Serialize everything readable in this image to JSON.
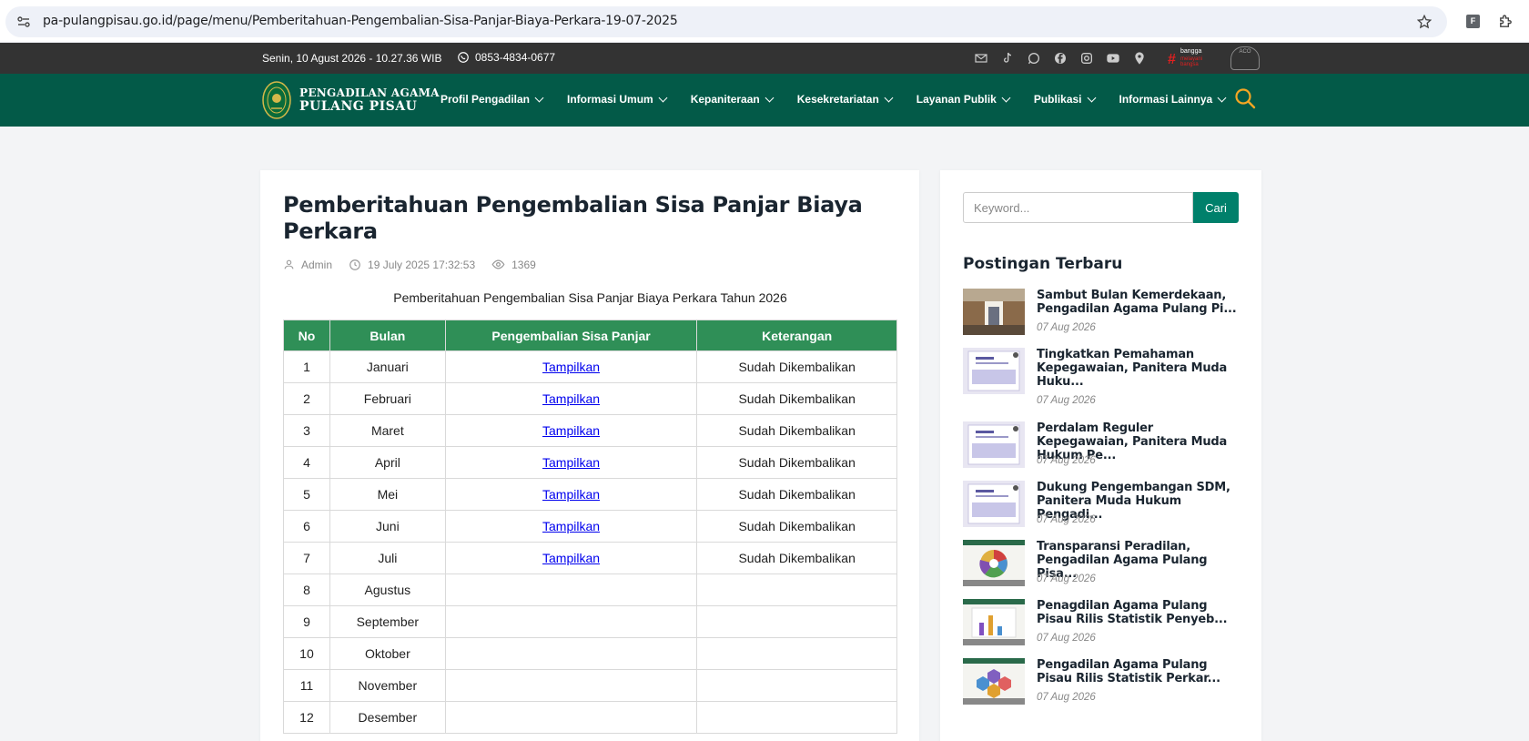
{
  "browser": {
    "url": "pa-pulangpisau.go.id/page/menu/Pemberitahuan-Pengembalian-Sisa-Panjar-Biaya-Perkara-19-07-2025",
    "extension_label": "F"
  },
  "topbar": {
    "datetime": "Senin, 10 Agust 2026 - 10.27.36 WIB",
    "phone": "0853-4834-0677",
    "social_icons": [
      "mail-icon",
      "tiktok-icon",
      "whatsapp-icon",
      "facebook-icon",
      "instagram-icon",
      "youtube-icon",
      "location-icon"
    ],
    "bangga_small": "bangga",
    "bangga_big": "#",
    "bangga_tag": "melayani bangsa",
    "aco_label": "ACO"
  },
  "header": {
    "logo_line1": "PENGADILAN AGAMA",
    "logo_line2": "PULANG PISAU",
    "nav": [
      {
        "label": "Profil Pengadilan"
      },
      {
        "label": "Informasi Umum"
      },
      {
        "label": "Kepaniteraan"
      },
      {
        "label": "Kesekretariatan"
      },
      {
        "label": "Layanan Publik"
      },
      {
        "label": "Publikasi"
      },
      {
        "label": "Informasi Lainnya"
      }
    ],
    "accent": "#035a48",
    "search_color": "#f5a623"
  },
  "post": {
    "title": "Pemberitahuan Pengembalian Sisa Panjar Biaya Perkara",
    "author": "Admin",
    "datetime": "19 July 2025 17:32:53",
    "views": "1369",
    "subtitle": "Pemberitahuan Pengembalian Sisa Panjar Biaya Perkara Tahun 2026",
    "table": {
      "headers": [
        "No",
        "Bulan",
        "Pengembalian Sisa Panjar",
        "Keterangan"
      ],
      "rows": [
        {
          "no": "1",
          "bulan": "Januari",
          "link": "Tampilkan",
          "ket": "Sudah Dikembalikan"
        },
        {
          "no": "2",
          "bulan": "Februari",
          "link": "Tampilkan",
          "ket": "Sudah Dikembalikan"
        },
        {
          "no": "3",
          "bulan": "Maret",
          "link": "Tampilkan",
          "ket": "Sudah Dikembalikan"
        },
        {
          "no": "4",
          "bulan": "April",
          "link": "Tampilkan",
          "ket": "Sudah Dikembalikan"
        },
        {
          "no": "5",
          "bulan": "Mei",
          "link": "Tampilkan",
          "ket": "Sudah Dikembalikan"
        },
        {
          "no": "6",
          "bulan": "Juni",
          "link": "Tampilkan",
          "ket": "Sudah Dikembalikan"
        },
        {
          "no": "7",
          "bulan": "Juli",
          "link": "Tampilkan",
          "ket": "Sudah Dikembalikan"
        },
        {
          "no": "8",
          "bulan": "Agustus",
          "link": "",
          "ket": ""
        },
        {
          "no": "9",
          "bulan": "September",
          "link": "",
          "ket": ""
        },
        {
          "no": "10",
          "bulan": "Oktober",
          "link": "",
          "ket": ""
        },
        {
          "no": "11",
          "bulan": "November",
          "link": "",
          "ket": ""
        },
        {
          "no": "12",
          "bulan": "Desember",
          "link": "",
          "ket": ""
        }
      ],
      "header_color": "#2f8f57"
    }
  },
  "sidebar": {
    "search_placeholder": "Keyword...",
    "search_button": "Cari",
    "heading": "Postingan Terbaru",
    "posts": [
      {
        "title": "Sambut Bulan Kemerdekaan, Pengadilan Agama Pulang Pi...",
        "date": "07 Aug 2026"
      },
      {
        "title": "Tingkatkan Pemahaman Kepegawaian, Panitera Muda Huku...",
        "date": "07 Aug 2026"
      },
      {
        "title": "Perdalam Reguler Kepegawaian, Panitera Muda Hukum Pe...",
        "date": "07 Aug 2026"
      },
      {
        "title": "Dukung Pengembangan SDM, Panitera Muda Hukum Pengadi...",
        "date": "07 Aug 2026"
      },
      {
        "title": "Transparansi Peradilan, Pengadilan Agama Pulang Pisa...",
        "date": "07 Aug 2026"
      },
      {
        "title": "Penagdilan Agama Pulang Pisau Rilis Statistik Penyeb...",
        "date": "07 Aug 2026"
      },
      {
        "title": "Pengadilan Agama Pulang Pisau Rilis Statistik Perkar...",
        "date": "07 Aug 2026"
      }
    ]
  }
}
